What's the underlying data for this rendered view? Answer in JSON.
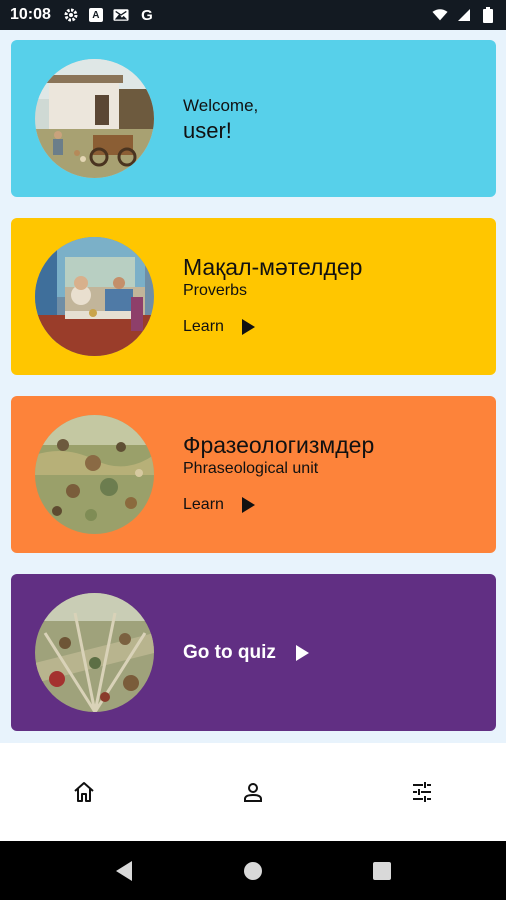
{
  "status_bar": {
    "time": "10:08",
    "a_icon_text": "A",
    "g_icon_text": "G"
  },
  "welcome": {
    "greeting": "Welcome,",
    "username": "user!"
  },
  "proverbs": {
    "title": "Мақал-мәтелдер",
    "subtitle": "Proverbs",
    "action": "Learn"
  },
  "phraseology": {
    "title": "Фразеологизмдер",
    "subtitle": "Phraseological unit",
    "action": "Learn"
  },
  "quiz": {
    "action": "Go to quiz"
  },
  "colors": {
    "welcome": "#57d0ea",
    "proverbs": "#ffc600",
    "phraseology": "#fd833a",
    "quiz": "#612f83",
    "background": "#e8f3fc"
  },
  "bottom_nav": {
    "items": [
      "home-icon",
      "person-icon",
      "tune-icon"
    ]
  },
  "system_nav": {
    "items": [
      "back-icon",
      "home-circle-icon",
      "recents-icon"
    ]
  }
}
